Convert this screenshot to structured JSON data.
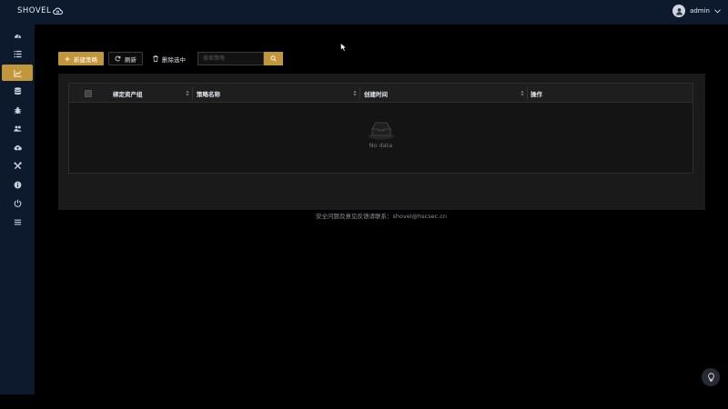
{
  "app": {
    "logo_text": "SHOVEL"
  },
  "user": {
    "name": "admin"
  },
  "sidebar": {
    "items": [
      {
        "icon": "dashboard-icon",
        "active": false
      },
      {
        "icon": "list-icon",
        "active": false
      },
      {
        "icon": "chart-icon",
        "active": true
      },
      {
        "icon": "database-icon",
        "active": false
      },
      {
        "icon": "bug-icon",
        "active": false
      },
      {
        "icon": "users-icon",
        "active": false
      },
      {
        "icon": "cloud-upload-icon",
        "active": false
      },
      {
        "icon": "tools-icon",
        "active": false
      },
      {
        "icon": "info-icon",
        "active": false
      },
      {
        "icon": "power-icon",
        "active": false
      },
      {
        "icon": "menu-icon",
        "active": false
      }
    ]
  },
  "toolbar": {
    "new_label": "新建策略",
    "refresh_label": "刷新",
    "delete_label": "删除选中",
    "search_placeholder": "搜索策略"
  },
  "table": {
    "columns": [
      "绑定资产组",
      "策略名称",
      "创建时间",
      "操作"
    ],
    "rows": [],
    "empty_text": "No data"
  },
  "footer": {
    "text": "安全问题及意见反馈请联系：shovel@hscsec.cn"
  },
  "colors": {
    "accent": "#c2963a",
    "topbar": "#0d1a2e",
    "panel": "#1a1a1a"
  }
}
